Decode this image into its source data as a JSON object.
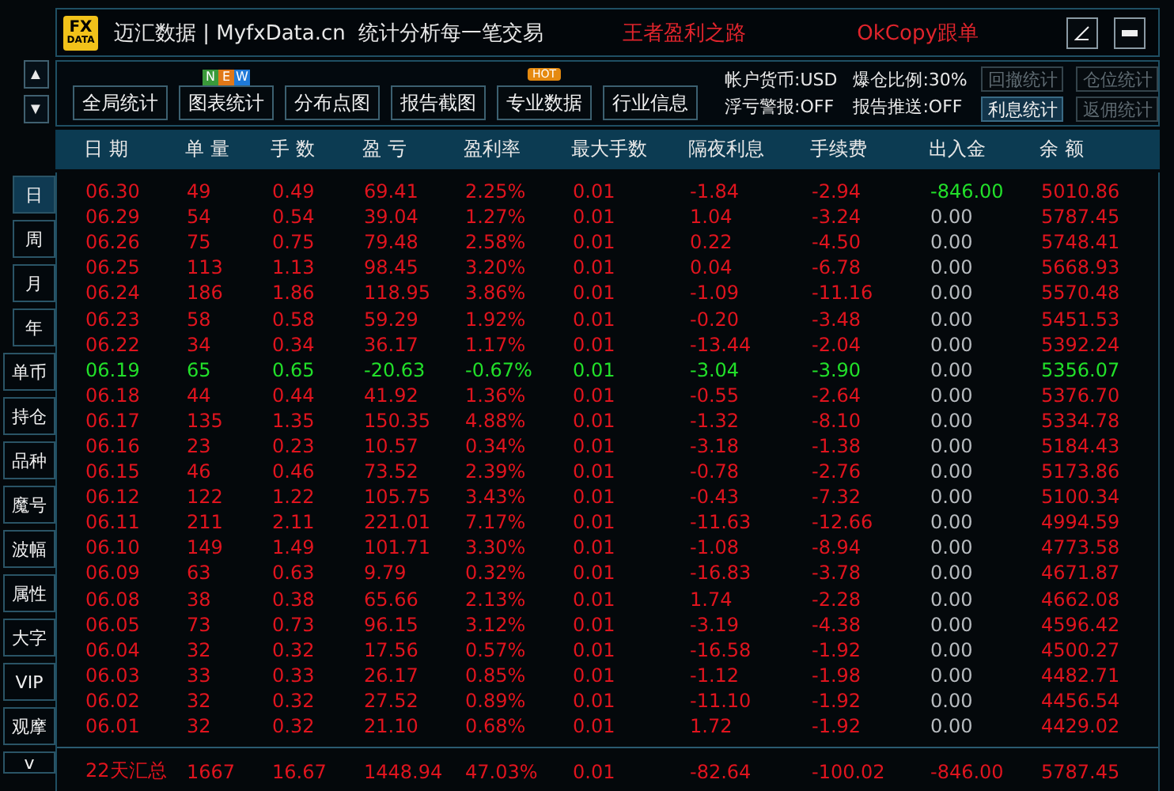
{
  "title_bar": {
    "logo": [
      "FX",
      "DATA"
    ],
    "title": "迈汇数据 | MyfxData.cn  统计分析每一笔交易",
    "slogans": [
      "王者盈利之路",
      "OkCopy跟单"
    ]
  },
  "scroll_arrows": [
    "▲",
    "▼"
  ],
  "toolbar": {
    "buttons": [
      {
        "label": "全局统计"
      },
      {
        "label": "图表统计",
        "badge_letters": [
          "N",
          "E",
          "W"
        ]
      },
      {
        "label": "分布点图"
      },
      {
        "label": "报告截图"
      },
      {
        "label": "专业数据",
        "hot_badge": "HOT"
      },
      {
        "label": "行业信息"
      }
    ],
    "info": [
      "帐户货币:USD",
      "爆仓比例:30%",
      "浮亏警报:OFF",
      "报告推送:OFF"
    ],
    "stat_buttons": [
      {
        "label": "回撤统计",
        "selected": false
      },
      {
        "label": "仓位统计",
        "selected": false
      },
      {
        "label": "利息统计",
        "selected": true
      },
      {
        "label": "返佣统计",
        "selected": false
      }
    ]
  },
  "side_tabs": [
    {
      "label": "日",
      "selected": true
    },
    {
      "label": "周",
      "selected": false
    },
    {
      "label": "月",
      "selected": false
    },
    {
      "label": "年",
      "selected": false
    },
    {
      "label": "单币",
      "selected": false
    },
    {
      "label": "持仓",
      "selected": false
    },
    {
      "label": "品种",
      "selected": false
    },
    {
      "label": "魔号",
      "selected": false
    },
    {
      "label": "波幅",
      "selected": false
    },
    {
      "label": "属性",
      "selected": false
    },
    {
      "label": "大字",
      "selected": false
    },
    {
      "label": "VIP",
      "selected": false
    },
    {
      "label": "观摩",
      "selected": false
    },
    {
      "label": "v",
      "selected": false
    }
  ],
  "table": {
    "columns": [
      "日 期",
      "单 量",
      "手 数",
      "盈 亏",
      "盈利率",
      "最大手数",
      "隔夜利息",
      "手续费",
      "出入金",
      "余 额"
    ],
    "rows": [
      {
        "color": "#e0141e",
        "cells": [
          "06.30",
          "49",
          "0.49",
          "69.41",
          "2.25%",
          "0.01",
          "-1.84",
          "-2.94",
          "5010.86"
        ],
        "cash": {
          "text": "-846.00",
          "color": "#22e02a"
        }
      },
      {
        "color": "#e0141e",
        "cells": [
          "06.29",
          "54",
          "0.54",
          "39.04",
          "1.27%",
          "0.01",
          "1.04",
          "-3.24",
          "5787.45"
        ],
        "cash": {
          "text": "0.00",
          "color": "#b8bcc0"
        }
      },
      {
        "color": "#e0141e",
        "cells": [
          "06.26",
          "75",
          "0.75",
          "79.48",
          "2.58%",
          "0.01",
          "0.22",
          "-4.50",
          "5748.41"
        ],
        "cash": {
          "text": "0.00",
          "color": "#b8bcc0"
        }
      },
      {
        "color": "#e0141e",
        "cells": [
          "06.25",
          "113",
          "1.13",
          "98.45",
          "3.20%",
          "0.01",
          "0.04",
          "-6.78",
          "5668.93"
        ],
        "cash": {
          "text": "0.00",
          "color": "#b8bcc0"
        }
      },
      {
        "color": "#e0141e",
        "cells": [
          "06.24",
          "186",
          "1.86",
          "118.95",
          "3.86%",
          "0.01",
          "-1.09",
          "-11.16",
          "5570.48"
        ],
        "cash": {
          "text": "0.00",
          "color": "#b8bcc0"
        }
      },
      {
        "color": "#e0141e",
        "cells": [
          "06.23",
          "58",
          "0.58",
          "59.29",
          "1.92%",
          "0.01",
          "-0.20",
          "-3.48",
          "5451.53"
        ],
        "cash": {
          "text": "0.00",
          "color": "#b8bcc0"
        }
      },
      {
        "color": "#e0141e",
        "cells": [
          "06.22",
          "34",
          "0.34",
          "36.17",
          "1.17%",
          "0.01",
          "-13.44",
          "-2.04",
          "5392.24"
        ],
        "cash": {
          "text": "0.00",
          "color": "#b8bcc0"
        }
      },
      {
        "color": "#22e02a",
        "cells": [
          "06.19",
          "65",
          "0.65",
          "-20.63",
          "-0.67%",
          "0.01",
          "-3.04",
          "-3.90",
          "5356.07"
        ],
        "cash": {
          "text": "0.00",
          "color": "#b8bcc0"
        }
      },
      {
        "color": "#e0141e",
        "cells": [
          "06.18",
          "44",
          "0.44",
          "41.92",
          "1.36%",
          "0.01",
          "-0.55",
          "-2.64",
          "5376.70"
        ],
        "cash": {
          "text": "0.00",
          "color": "#b8bcc0"
        }
      },
      {
        "color": "#e0141e",
        "cells": [
          "06.17",
          "135",
          "1.35",
          "150.35",
          "4.88%",
          "0.01",
          "-1.32",
          "-8.10",
          "5334.78"
        ],
        "cash": {
          "text": "0.00",
          "color": "#b8bcc0"
        }
      },
      {
        "color": "#e0141e",
        "cells": [
          "06.16",
          "23",
          "0.23",
          "10.57",
          "0.34%",
          "0.01",
          "-3.18",
          "-1.38",
          "5184.43"
        ],
        "cash": {
          "text": "0.00",
          "color": "#b8bcc0"
        }
      },
      {
        "color": "#e0141e",
        "cells": [
          "06.15",
          "46",
          "0.46",
          "73.52",
          "2.39%",
          "0.01",
          "-0.78",
          "-2.76",
          "5173.86"
        ],
        "cash": {
          "text": "0.00",
          "color": "#b8bcc0"
        }
      },
      {
        "color": "#e0141e",
        "cells": [
          "06.12",
          "122",
          "1.22",
          "105.75",
          "3.43%",
          "0.01",
          "-0.43",
          "-7.32",
          "5100.34"
        ],
        "cash": {
          "text": "0.00",
          "color": "#b8bcc0"
        }
      },
      {
        "color": "#e0141e",
        "cells": [
          "06.11",
          "211",
          "2.11",
          "221.01",
          "7.17%",
          "0.01",
          "-11.63",
          "-12.66",
          "4994.59"
        ],
        "cash": {
          "text": "0.00",
          "color": "#b8bcc0"
        }
      },
      {
        "color": "#e0141e",
        "cells": [
          "06.10",
          "149",
          "1.49",
          "101.71",
          "3.30%",
          "0.01",
          "-1.08",
          "-8.94",
          "4773.58"
        ],
        "cash": {
          "text": "0.00",
          "color": "#b8bcc0"
        }
      },
      {
        "color": "#e0141e",
        "cells": [
          "06.09",
          "63",
          "0.63",
          "9.79",
          "0.32%",
          "0.01",
          "-16.83",
          "-3.78",
          "4671.87"
        ],
        "cash": {
          "text": "0.00",
          "color": "#b8bcc0"
        }
      },
      {
        "color": "#e0141e",
        "cells": [
          "06.08",
          "38",
          "0.38",
          "65.66",
          "2.13%",
          "0.01",
          "1.74",
          "-2.28",
          "4662.08"
        ],
        "cash": {
          "text": "0.00",
          "color": "#b8bcc0"
        }
      },
      {
        "color": "#e0141e",
        "cells": [
          "06.05",
          "73",
          "0.73",
          "96.15",
          "3.12%",
          "0.01",
          "-3.19",
          "-4.38",
          "4596.42"
        ],
        "cash": {
          "text": "0.00",
          "color": "#b8bcc0"
        }
      },
      {
        "color": "#e0141e",
        "cells": [
          "06.04",
          "32",
          "0.32",
          "17.56",
          "0.57%",
          "0.01",
          "-16.58",
          "-1.92",
          "4500.27"
        ],
        "cash": {
          "text": "0.00",
          "color": "#b8bcc0"
        }
      },
      {
        "color": "#e0141e",
        "cells": [
          "06.03",
          "33",
          "0.33",
          "26.17",
          "0.85%",
          "0.01",
          "-1.12",
          "-1.98",
          "4482.71"
        ],
        "cash": {
          "text": "0.00",
          "color": "#b8bcc0"
        }
      },
      {
        "color": "#e0141e",
        "cells": [
          "06.02",
          "32",
          "0.32",
          "27.52",
          "0.89%",
          "0.01",
          "-11.10",
          "-1.92",
          "4456.54"
        ],
        "cash": {
          "text": "0.00",
          "color": "#b8bcc0"
        }
      },
      {
        "color": "#e0141e",
        "cells": [
          "06.01",
          "32",
          "0.32",
          "21.10",
          "0.68%",
          "0.01",
          "1.72",
          "-1.92",
          "4429.02"
        ],
        "cash": {
          "text": "0.00",
          "color": "#b8bcc0"
        }
      }
    ],
    "total": {
      "color": "#e0141e",
      "cells": [
        "22天汇总",
        "1667",
        "16.67",
        "1448.94",
        "47.03%",
        "0.01",
        "-82.64",
        "-100.02",
        "5787.45"
      ],
      "cash": {
        "text": "-846.00",
        "color": "#e0141e"
      }
    }
  }
}
